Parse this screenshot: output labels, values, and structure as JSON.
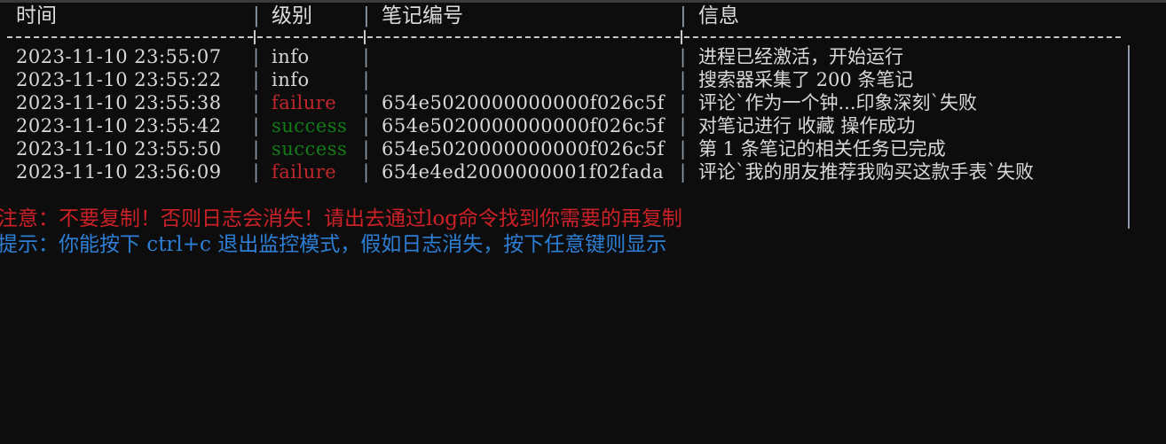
{
  "window": {
    "background_color": "#0d0d0d",
    "top_strip_color": "#3a3a3a"
  },
  "colors": {
    "text": "#d8d8d8",
    "rule": "#c8c8c8",
    "pipe": "#8d99a6",
    "info": "#d4d4d4",
    "failure": "#c0272d",
    "success": "#127c18",
    "warning": "#cc2127",
    "hint": "#2d7fd6"
  },
  "table": {
    "columns": [
      {
        "key": "time",
        "label": "时间"
      },
      {
        "key": "level",
        "label": "级别"
      },
      {
        "key": "note_id",
        "label": "笔记编号"
      },
      {
        "key": "message",
        "label": "信息"
      }
    ],
    "separator": {
      "dash_char": "-",
      "cross_char": "+"
    },
    "pipe_char": "|",
    "rows": [
      {
        "time": "2023-11-10 23:55:07",
        "level": "info",
        "level_color": "#d4d4d4",
        "note_id": "",
        "message": "进程已经激活，开始运行"
      },
      {
        "time": "2023-11-10 23:55:22",
        "level": "info",
        "level_color": "#d4d4d4",
        "note_id": "",
        "message": "搜索器采集了 200 条笔记"
      },
      {
        "time": "2023-11-10 23:55:38",
        "level": "failure",
        "level_color": "#c0272d",
        "note_id": "654e5020000000000f026c5f",
        "message": "评论`作为一个钟...印象深刻`失败"
      },
      {
        "time": "2023-11-10 23:55:42",
        "level": "success",
        "level_color": "#127c18",
        "note_id": "654e5020000000000f026c5f",
        "message": "对笔记进行 收藏 操作成功"
      },
      {
        "time": "2023-11-10 23:55:50",
        "level": "success",
        "level_color": "#127c18",
        "note_id": "654e5020000000000f026c5f",
        "message": "第 1 条笔记的相关任务已完成"
      },
      {
        "time": "2023-11-10 23:56:09",
        "level": "failure",
        "level_color": "#c0272d",
        "note_id": "654e4ed2000000001f02fada",
        "message": "评论`我的朋友推荐我购买这款手表`失败"
      }
    ]
  },
  "notes": {
    "warning": "注意：不要复制！否则日志会消失！请出去通过log命令找到你需要的再复制",
    "hint": "提示：你能按下 ctrl+c 退出监控模式，假如日志消失，按下任意键则显示"
  }
}
